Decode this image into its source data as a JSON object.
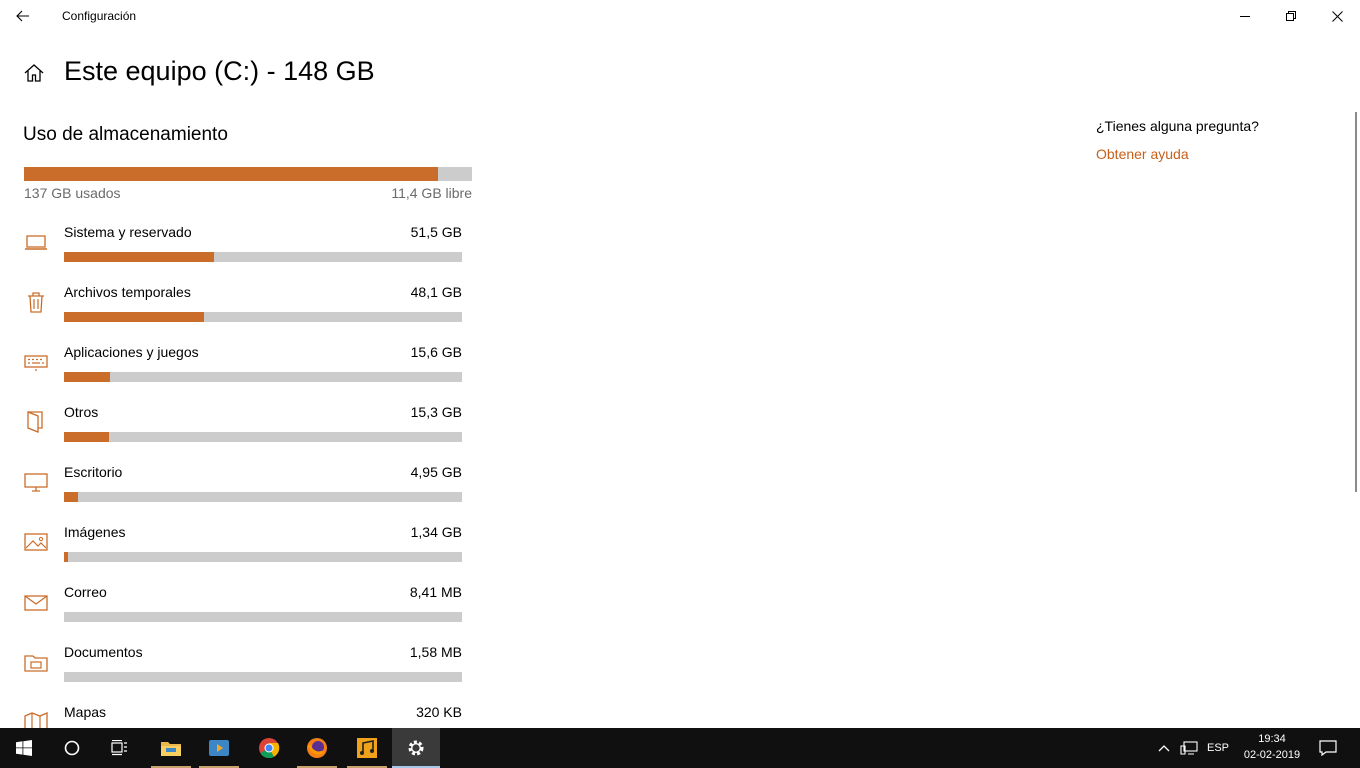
{
  "window": {
    "title": "Configuración"
  },
  "header": {
    "title": "Este equipo (C:) - 148 GB"
  },
  "storage": {
    "section_title": "Uso de almacenamiento",
    "used_label": "137 GB usados",
    "free_label": "11,4 GB libre",
    "used_fraction": 0.924
  },
  "categories": [
    {
      "name": "Sistema y reservado",
      "size": "51,5 GB",
      "fraction": 0.377,
      "icon": "laptop-icon"
    },
    {
      "name": "Archivos temporales",
      "size": "48,1 GB",
      "fraction": 0.352,
      "icon": "trash-icon"
    },
    {
      "name": "Aplicaciones y juegos",
      "size": "15,6 GB",
      "fraction": 0.116,
      "icon": "keyboard-icon"
    },
    {
      "name": "Otros",
      "size": "15,3 GB",
      "fraction": 0.113,
      "icon": "document-icon"
    },
    {
      "name": "Escritorio",
      "size": "4,95 GB",
      "fraction": 0.035,
      "icon": "monitor-icon"
    },
    {
      "name": "Imágenes",
      "size": "1,34 GB",
      "fraction": 0.01,
      "icon": "image-icon"
    },
    {
      "name": "Correo",
      "size": "8,41 MB",
      "fraction": 0.0,
      "icon": "mail-icon"
    },
    {
      "name": "Documentos",
      "size": "1,58 MB",
      "fraction": 0.0,
      "icon": "folder-icon"
    },
    {
      "name": "Mapas",
      "size": "320 KB",
      "fraction": 0.0,
      "icon": "map-icon"
    }
  ],
  "help": {
    "question": "¿Tienes alguna pregunta?",
    "link": "Obtener ayuda"
  },
  "taskbar": {
    "language": "ESP",
    "time": "19:34",
    "date": "02-02-2019"
  },
  "colors": {
    "accent": "#ca6d2a",
    "link": "#c5601b",
    "track": "#cccccc",
    "taskbar": "#101010"
  }
}
